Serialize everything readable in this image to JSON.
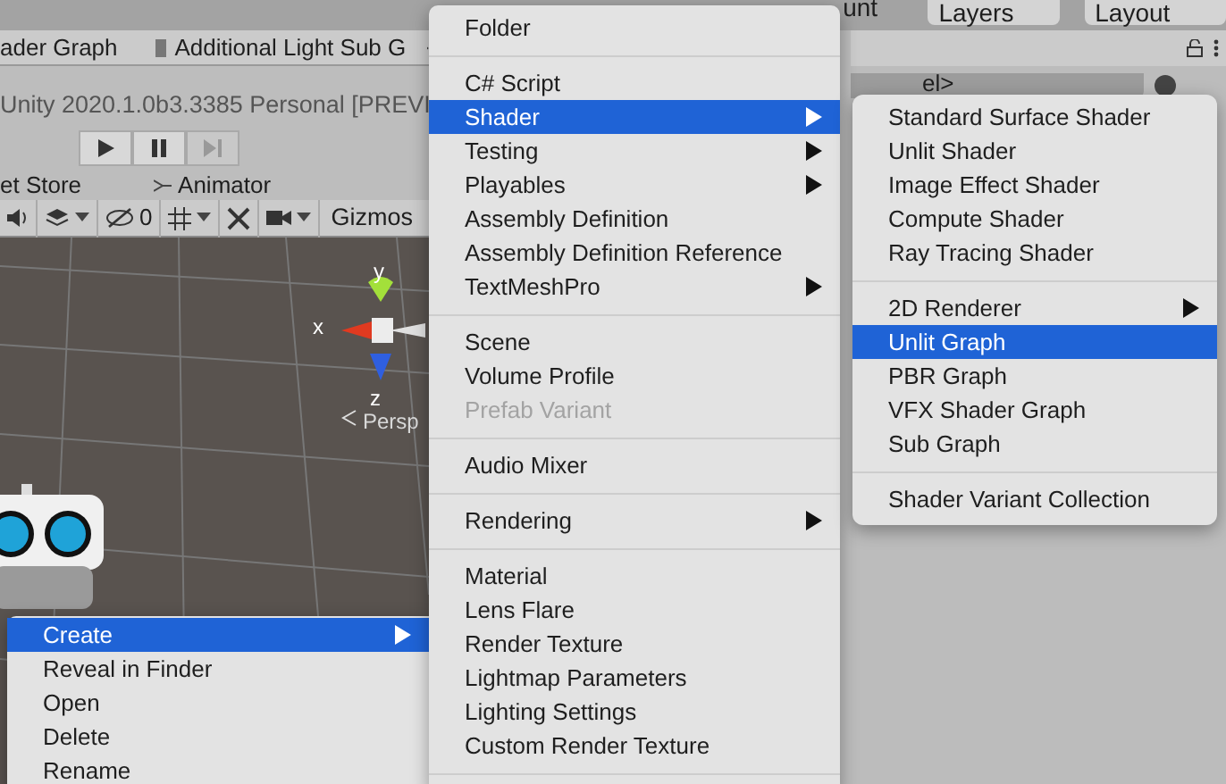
{
  "top_toolbar": {
    "account_label": "unt",
    "layers_label": "Layers",
    "layout_label": "Layout"
  },
  "editor_tabs": [
    {
      "label": "ader Graph"
    },
    {
      "label": "Additional Light Sub G"
    }
  ],
  "game_view": {
    "title": "Unity 2020.1.0b3.3385 Personal [PREVI",
    "play_buttons": [
      {
        "kind": "play",
        "disabled": false
      },
      {
        "kind": "pause",
        "disabled": false
      },
      {
        "kind": "step",
        "disabled": true
      }
    ]
  },
  "scene_tabs": [
    {
      "label": "et Store",
      "kind": "plain"
    },
    {
      "label": "Animator",
      "kind": "animator"
    }
  ],
  "scene_toolbar": {
    "hidden_count": "0",
    "gizmos_label": "Gizmos"
  },
  "scene": {
    "axis_y": "y",
    "axis_x": "x",
    "axis_z": "z",
    "projection_label": "Persp"
  },
  "inspector": {
    "field_value": "el>"
  },
  "context_menu": [
    {
      "kind": "item",
      "label": "Create",
      "selected": true,
      "disabled": false,
      "submenu": true
    },
    {
      "kind": "item",
      "label": "Reveal in Finder",
      "selected": false,
      "disabled": false,
      "submenu": false
    },
    {
      "kind": "item",
      "label": "Open",
      "selected": false,
      "disabled": false,
      "submenu": false
    },
    {
      "kind": "item",
      "label": "Delete",
      "selected": false,
      "disabled": false,
      "submenu": false
    },
    {
      "kind": "item",
      "label": "Rename",
      "selected": false,
      "disabled": false,
      "submenu": false
    }
  ],
  "create_menu": [
    {
      "kind": "item",
      "label": "Folder",
      "selected": false,
      "disabled": false,
      "submenu": false
    },
    {
      "kind": "separator"
    },
    {
      "kind": "item",
      "label": "C# Script",
      "selected": false,
      "disabled": false,
      "submenu": false
    },
    {
      "kind": "item",
      "label": "Shader",
      "selected": true,
      "disabled": false,
      "submenu": true
    },
    {
      "kind": "item",
      "label": "Testing",
      "selected": false,
      "disabled": false,
      "submenu": true
    },
    {
      "kind": "item",
      "label": "Playables",
      "selected": false,
      "disabled": false,
      "submenu": true
    },
    {
      "kind": "item",
      "label": "Assembly Definition",
      "selected": false,
      "disabled": false,
      "submenu": false
    },
    {
      "kind": "item",
      "label": "Assembly Definition Reference",
      "selected": false,
      "disabled": false,
      "submenu": false
    },
    {
      "kind": "item",
      "label": "TextMeshPro",
      "selected": false,
      "disabled": false,
      "submenu": true
    },
    {
      "kind": "separator"
    },
    {
      "kind": "item",
      "label": "Scene",
      "selected": false,
      "disabled": false,
      "submenu": false
    },
    {
      "kind": "item",
      "label": "Volume Profile",
      "selected": false,
      "disabled": false,
      "submenu": false
    },
    {
      "kind": "item",
      "label": "Prefab Variant",
      "selected": false,
      "disabled": true,
      "submenu": false
    },
    {
      "kind": "separator"
    },
    {
      "kind": "item",
      "label": "Audio Mixer",
      "selected": false,
      "disabled": false,
      "submenu": false
    },
    {
      "kind": "separator"
    },
    {
      "kind": "item",
      "label": "Rendering",
      "selected": false,
      "disabled": false,
      "submenu": true
    },
    {
      "kind": "separator"
    },
    {
      "kind": "item",
      "label": "Material",
      "selected": false,
      "disabled": false,
      "submenu": false
    },
    {
      "kind": "item",
      "label": "Lens Flare",
      "selected": false,
      "disabled": false,
      "submenu": false
    },
    {
      "kind": "item",
      "label": "Render Texture",
      "selected": false,
      "disabled": false,
      "submenu": false
    },
    {
      "kind": "item",
      "label": "Lightmap Parameters",
      "selected": false,
      "disabled": false,
      "submenu": false
    },
    {
      "kind": "item",
      "label": "Lighting Settings",
      "selected": false,
      "disabled": false,
      "submenu": false
    },
    {
      "kind": "item",
      "label": "Custom Render Texture",
      "selected": false,
      "disabled": false,
      "submenu": false
    },
    {
      "kind": "separator"
    }
  ],
  "shader_submenu": [
    {
      "kind": "item",
      "label": "Standard Surface Shader",
      "selected": false,
      "disabled": false,
      "submenu": false
    },
    {
      "kind": "item",
      "label": "Unlit Shader",
      "selected": false,
      "disabled": false,
      "submenu": false
    },
    {
      "kind": "item",
      "label": "Image Effect Shader",
      "selected": false,
      "disabled": false,
      "submenu": false
    },
    {
      "kind": "item",
      "label": "Compute Shader",
      "selected": false,
      "disabled": false,
      "submenu": false
    },
    {
      "kind": "item",
      "label": "Ray Tracing Shader",
      "selected": false,
      "disabled": false,
      "submenu": false
    },
    {
      "kind": "separator"
    },
    {
      "kind": "item",
      "label": "2D Renderer",
      "selected": false,
      "disabled": false,
      "submenu": true
    },
    {
      "kind": "item",
      "label": "Unlit Graph",
      "selected": true,
      "disabled": false,
      "submenu": false
    },
    {
      "kind": "item",
      "label": "PBR Graph",
      "selected": false,
      "disabled": false,
      "submenu": false
    },
    {
      "kind": "item",
      "label": "VFX Shader Graph",
      "selected": false,
      "disabled": false,
      "submenu": false
    },
    {
      "kind": "item",
      "label": "Sub Graph",
      "selected": false,
      "disabled": false,
      "submenu": false
    },
    {
      "kind": "separator"
    },
    {
      "kind": "item",
      "label": "Shader Variant Collection",
      "selected": false,
      "disabled": false,
      "submenu": false
    }
  ]
}
